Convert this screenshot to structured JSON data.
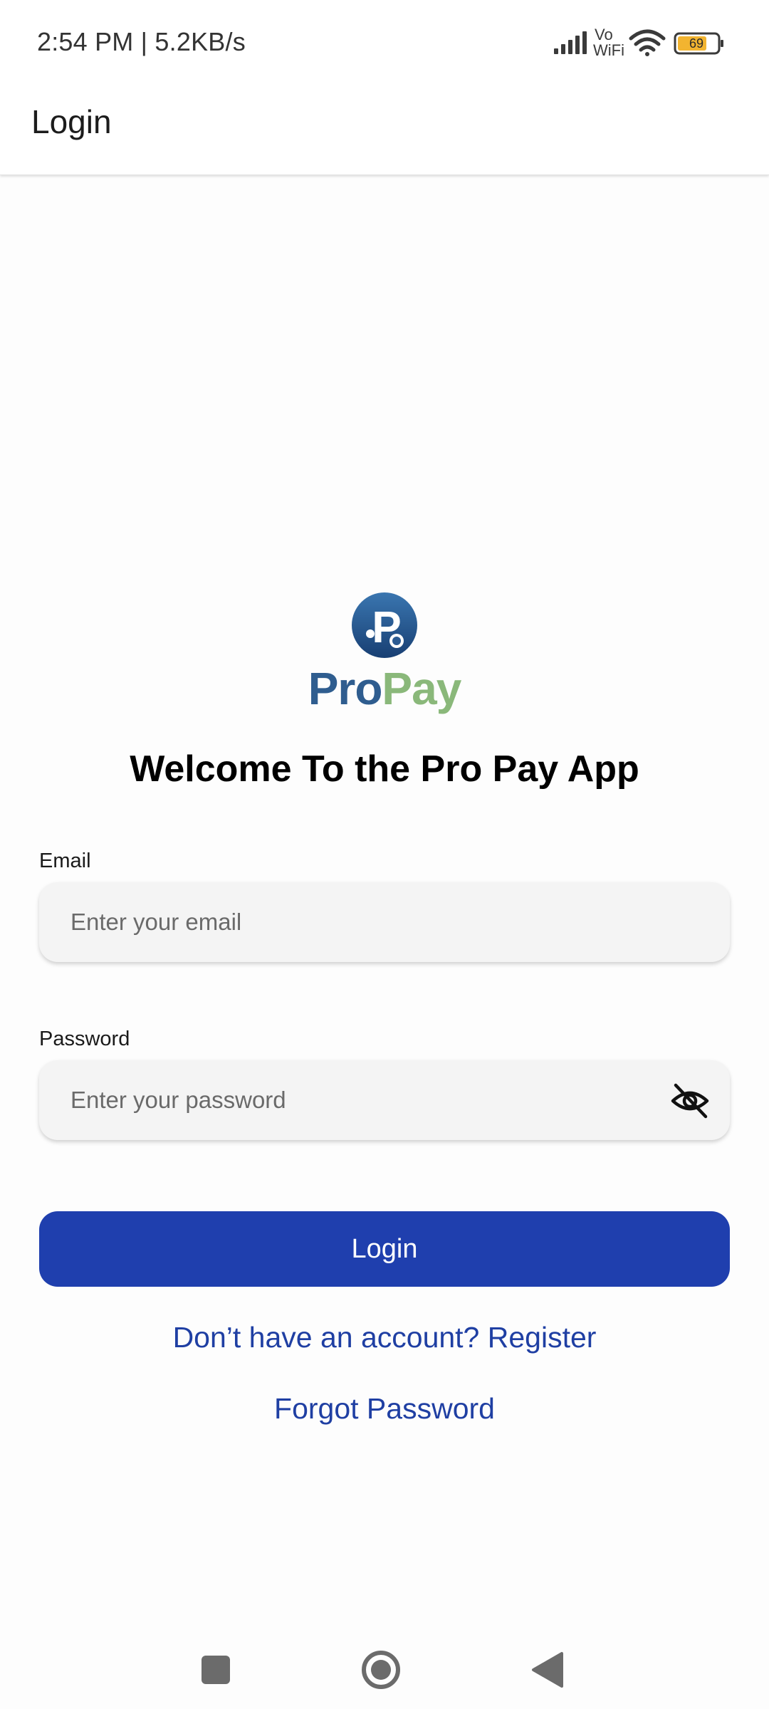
{
  "status_bar": {
    "time_speed": "2:54 PM | 5.2KB/s",
    "vowifi_top": "Vo",
    "vowifi_bottom": "WiFi",
    "battery_level": "69",
    "icons": [
      "signal-icon",
      "vowifi-icon",
      "wifi-icon",
      "battery-icon"
    ]
  },
  "app_bar": {
    "title": "Login"
  },
  "logo": {
    "letter": "P",
    "wordmark_left": "Pro",
    "wordmark_right": "Pay"
  },
  "welcome": "Welcome To the Pro Pay App",
  "email": {
    "label": "Email",
    "placeholder": "Enter your email",
    "value": ""
  },
  "password": {
    "label": "Password",
    "placeholder": "Enter your password",
    "value": "",
    "toggle_icon": "eye-off-icon"
  },
  "login_button": "Login",
  "register_link": "Don’t have an account? Register",
  "forgot_link": "Forgot Password",
  "nav": [
    "recents-icon",
    "home-icon",
    "back-icon"
  ],
  "colors": {
    "primary": "#1f3fae",
    "link": "#1f3fa3",
    "logo_blue": "#2f5d8f",
    "logo_green": "#8ab87a",
    "battery": "#f2b430"
  }
}
